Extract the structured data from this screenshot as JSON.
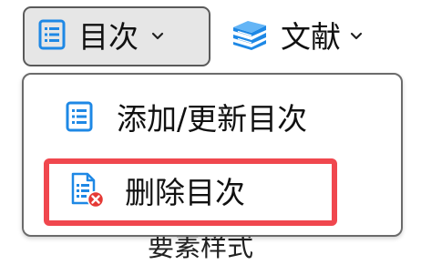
{
  "toolbar": {
    "toc_button": {
      "label": "目次",
      "icon": "toc-list-icon"
    },
    "references_button": {
      "label": "文献",
      "icon": "books-stack-icon"
    }
  },
  "toc_menu": {
    "items": [
      {
        "label": "添加/更新目次",
        "icon": "toc-list-icon",
        "highlighted": false
      },
      {
        "label": "删除目次",
        "icon": "document-delete-icon",
        "highlighted": true
      }
    ],
    "highlight_color": "#f0474e"
  },
  "background": {
    "partial_text": "要素样式"
  },
  "colors": {
    "icon_blue": "#1e88e5",
    "delete_red": "#e53935",
    "toolbar_active_bg": "#e6e6e6"
  }
}
